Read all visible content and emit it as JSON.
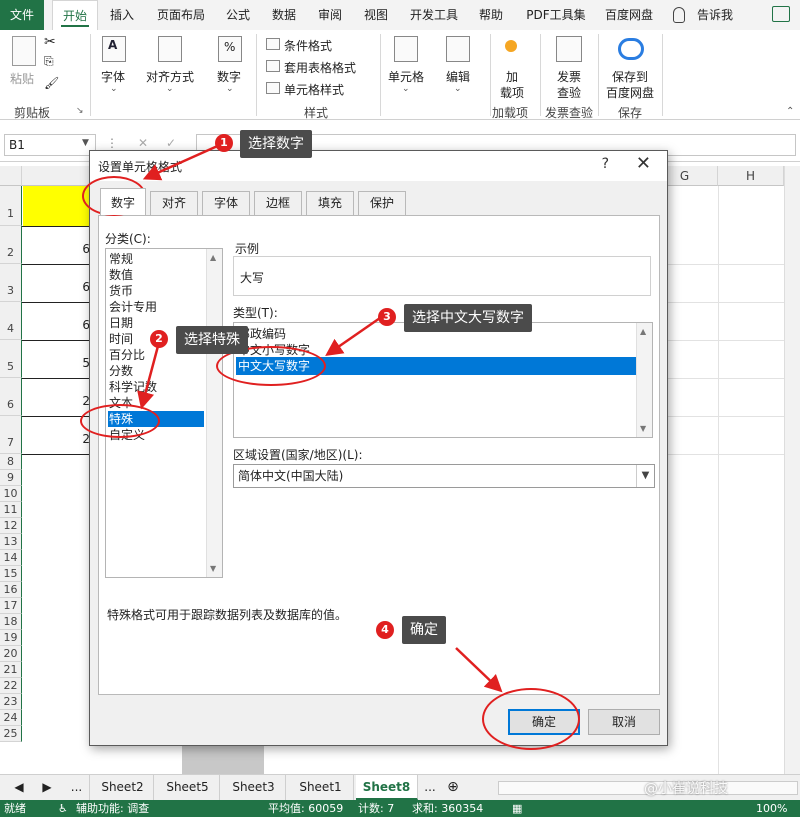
{
  "ribbon_tabs": [
    "文件",
    "开始",
    "插入",
    "页面布局",
    "公式",
    "数据",
    "审阅",
    "视图",
    "开发工具",
    "帮助",
    "PDF工具集",
    "百度网盘",
    "告诉我"
  ],
  "ribbon": {
    "paste": "粘贴",
    "clipboard": "剪贴板",
    "font": "字体",
    "align": "对齐方式",
    "number": "数字",
    "cond_format": "条件格式",
    "table_format": "套用表格格式",
    "cell_style": "单元格样式",
    "style": "样式",
    "cells": "单元格",
    "edit": "编辑",
    "addin_line1": "加",
    "addin_line2": "载项",
    "addins": "加载项",
    "invoice_line1": "发票",
    "invoice_line2": "查验",
    "invoice_group": "发票查验",
    "save_line1": "保存到",
    "save_line2": "百度网盘",
    "save_group": "保存"
  },
  "formula_bar": {
    "name_box": "B1"
  },
  "grid": {
    "columns": [
      "G",
      "H"
    ],
    "rows": [
      "1",
      "2",
      "3",
      "4",
      "5",
      "6",
      "7",
      "8",
      "9",
      "10",
      "11",
      "12",
      "13",
      "14",
      "15",
      "16",
      "17",
      "18",
      "19",
      "20",
      "21",
      "22",
      "23",
      "24",
      "25"
    ],
    "cells_b": [
      "6",
      "6",
      "6",
      "5",
      "2",
      "2"
    ]
  },
  "sheets": [
    "Sheet2",
    "Sheet5",
    "Sheet3",
    "Sheet1",
    "Sheet8"
  ],
  "sheet_nav": {
    "dots": "..."
  },
  "status": {
    "ready": "就绪",
    "accessibility": "辅助功能: 调查",
    "average": "平均值: 60059",
    "count": "计数: 7",
    "sum": "求和: 360354",
    "zoom": "100%"
  },
  "dialog": {
    "title": "设置单元格格式",
    "help": "?",
    "close": "✕",
    "tabs": [
      "数字",
      "对齐",
      "字体",
      "边框",
      "填充",
      "保护"
    ],
    "category_label": "分类(C):",
    "categories": [
      "常规",
      "数值",
      "货币",
      "会计专用",
      "日期",
      "时间",
      "百分比",
      "分数",
      "科学记数",
      "文本",
      "特殊",
      "自定义"
    ],
    "selected_category": "特殊",
    "sample_label": "示例",
    "sample_value": "大写",
    "type_label": "类型(T):",
    "types": [
      "邮政编码",
      "中文小写数字",
      "中文大写数字"
    ],
    "locale_label": "区域设置(国家/地区)(L):",
    "locale_value": "简体中文(中国大陆)",
    "description": "特殊格式可用于跟踪数据列表及数据库的值。",
    "ok": "确定",
    "cancel": "取消"
  },
  "annotations": [
    {
      "num": "1",
      "text": "选择数字"
    },
    {
      "num": "2",
      "text": "选择特殊"
    },
    {
      "num": "3",
      "text": "选择中文大写数字"
    },
    {
      "num": "4",
      "text": "确定"
    }
  ],
  "watermark": "@小崔说科技",
  "colors": {
    "excel_green": "#217346",
    "selection_blue": "#0078d7",
    "annotation_red": "#e02020",
    "yellow_fill": "#ffff00"
  }
}
